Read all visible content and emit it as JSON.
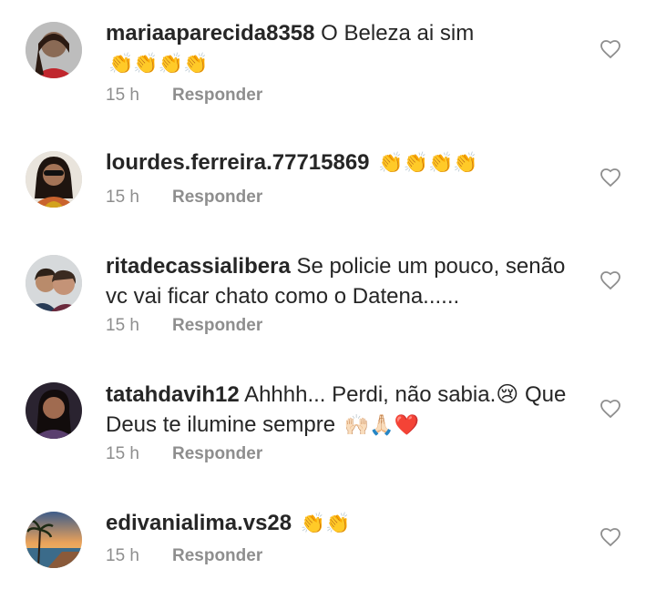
{
  "comments": [
    {
      "username": "mariaaparecida8358",
      "text": "O Beleza  ai sim",
      "emojis": "👏👏👏👏",
      "time": "15 h",
      "reply_label": "Responder",
      "avatar": "avatar-woman-red-shirt"
    },
    {
      "username": "lourdes.ferreira.77715869",
      "text": "",
      "emojis": "👏👏👏👏",
      "time": "15 h",
      "reply_label": "Responder",
      "avatar": "avatar-woman-sunglasses"
    },
    {
      "username": "ritadecassialibera",
      "text": "Se policie um pouco, senão vc vai ficar chato como o Datena......",
      "emojis": "",
      "time": "15 h",
      "reply_label": "Responder",
      "avatar": "avatar-two-people"
    },
    {
      "username": "tatahdavih12",
      "text": "Ahhhh... Perdi, não sabia.😢 Que Deus te ilumine sempre",
      "emojis": "🙌🏻🙏🏻❤️",
      "time": "15 h",
      "reply_label": "Responder",
      "avatar": "avatar-woman-dark-hair"
    },
    {
      "username": "edivanialima.vs28",
      "text": "",
      "emojis": "👏👏",
      "time": "15 h",
      "reply_label": "Responder",
      "avatar": "avatar-beach-sunset"
    }
  ],
  "colors": {
    "text": "#262626",
    "meta": "#8e8e8e",
    "heart": "#8e8e8e"
  }
}
